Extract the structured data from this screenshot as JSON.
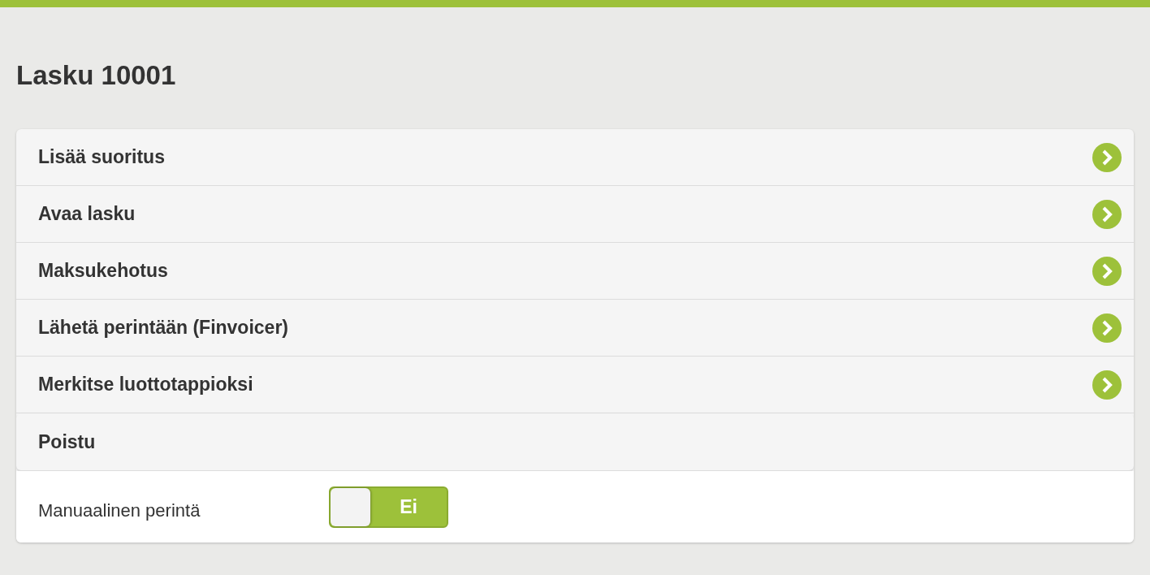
{
  "title": "Lasku 10001",
  "actions": [
    {
      "label": "Lisää suoritus",
      "kind": "link"
    },
    {
      "label": "Avaa lasku",
      "kind": "link"
    },
    {
      "label": "Maksukehotus",
      "kind": "link"
    },
    {
      "label": "Lähetä perintään (Finvoicer)",
      "kind": "link"
    },
    {
      "label": "Merkitse luottotappioksi",
      "kind": "link"
    },
    {
      "label": "Poistu",
      "kind": "plain"
    }
  ],
  "setting": {
    "label": "Manuaalinen perintä",
    "on": false,
    "value": "Ei"
  }
}
